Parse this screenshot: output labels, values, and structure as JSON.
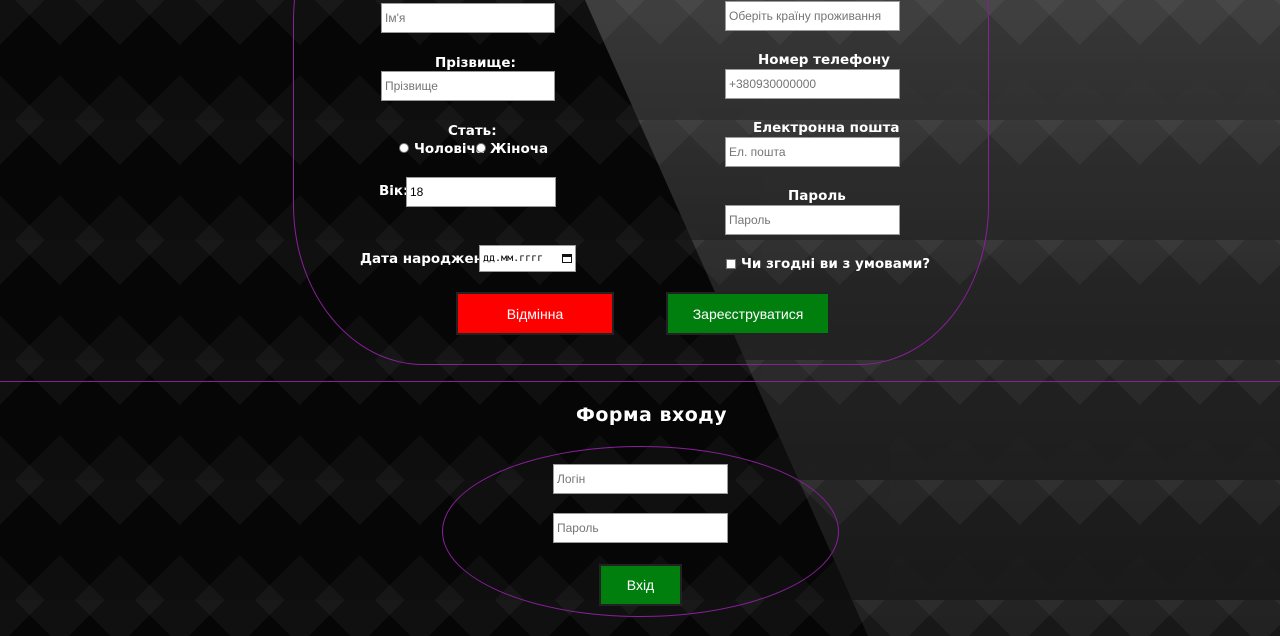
{
  "registration": {
    "first_name_placeholder": "Ім'я",
    "last_name_label": "Прізвище:",
    "last_name_placeholder": "Прізвище",
    "gender_label": "Стать:",
    "gender_options": [
      "Чоловіча",
      "Жіноча"
    ],
    "age_label": "Вік:",
    "age_value": "18",
    "birth_date_label": "Дата народження:",
    "birth_date_placeholder": "дд.мм.гггг",
    "country_placeholder": "Оберіть країну проживання",
    "phone_label": "Номер телефону",
    "phone_placeholder": "+380930000000",
    "email_label": "Електронна пошта",
    "email_placeholder": "Ел. пошта",
    "password_label": "Пароль",
    "password_placeholder": "Пароль",
    "terms_label": "Чи згодні ви з умовами?",
    "cancel_label": "Відмінна",
    "submit_label": "Зареєструватися"
  },
  "login": {
    "title": "Форма входу",
    "login_placeholder": "Логін",
    "password_placeholder": "Пароль",
    "submit_label": "Вхід"
  },
  "colors": {
    "accent_border": "#8a1f9c",
    "cancel_button": "#ff0000",
    "submit_button": "#007f0e"
  }
}
